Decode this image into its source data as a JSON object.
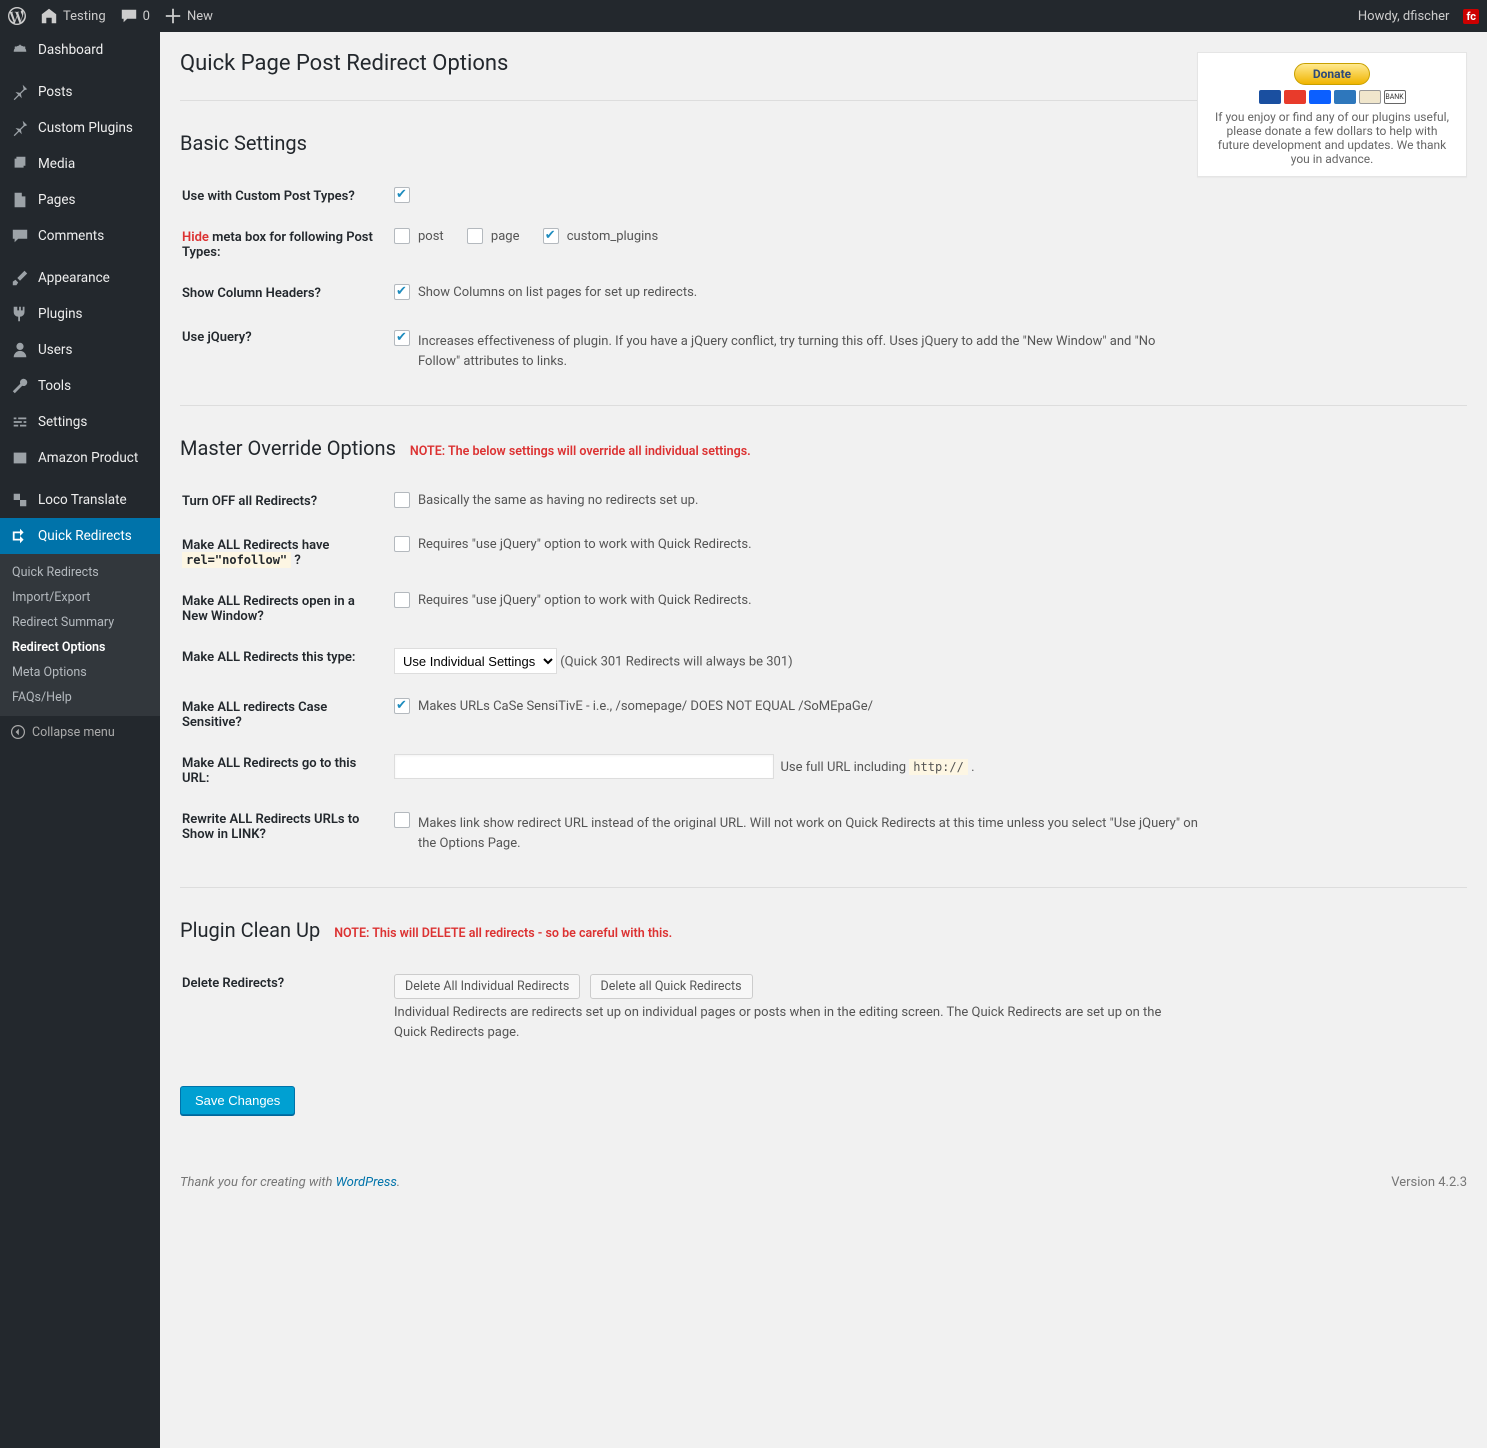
{
  "adminbar": {
    "site": "Testing",
    "comments": "0",
    "new": "New",
    "howdy": "Howdy, dfischer",
    "fc": "fc"
  },
  "menu": {
    "dashboard": "Dashboard",
    "posts": "Posts",
    "custom_plugins": "Custom Plugins",
    "media": "Media",
    "pages": "Pages",
    "comments": "Comments",
    "appearance": "Appearance",
    "plugins": "Plugins",
    "users": "Users",
    "tools": "Tools",
    "settings": "Settings",
    "amazon": "Amazon Product",
    "loco": "Loco Translate",
    "quick_redirects": "Quick Redirects",
    "collapse": "Collapse menu",
    "sub": {
      "quick_redirects": "Quick Redirects",
      "import_export": "Import/Export",
      "redirect_summary": "Redirect Summary",
      "redirect_options": "Redirect Options",
      "meta_options": "Meta Options",
      "faqs_help": "FAQs/Help"
    }
  },
  "page_title": "Quick Page Post Redirect Options",
  "donate": {
    "button": "Donate",
    "bank": "BANK",
    "text": "If you enjoy or find any of our plugins useful, please donate a few dollars to help with future development and updates. We thank you in advance."
  },
  "basic": {
    "title": "Basic Settings",
    "use_cpt_label": "Use with Custom Post Types?",
    "hide_word": "Hide",
    "hide_rest": "meta box for following Post Types:",
    "opt_post": "post",
    "opt_page": "page",
    "opt_cp": "custom_plugins",
    "show_columns_label": "Show Column Headers?",
    "show_columns_desc": "Show Columns on list pages for set up redirects.",
    "use_jquery_label": "Use jQuery?",
    "use_jquery_desc": "Increases effectiveness of plugin. If you have a jQuery conflict, try turning this off. Uses jQuery to add the \"New Window\" and \"No Follow\" attributes to links."
  },
  "master": {
    "title": "Master Override Options",
    "note": "NOTE: The below settings will override all individual settings.",
    "turn_off_label": "Turn OFF all Redirects?",
    "turn_off_desc": "Basically the same as having no redirects set up.",
    "nofollow_label_a": "Make ALL Redirects have ",
    "nofollow_code": "rel=\"nofollow\"",
    "nofollow_label_b": " ?",
    "nofollow_desc": "Requires \"use jQuery\" option to work with Quick Redirects.",
    "new_window_label": "Make ALL Redirects open in a New Window?",
    "new_window_desc": "Requires \"use jQuery\" option to work with Quick Redirects.",
    "this_type_label": "Make ALL Redirects this type:",
    "this_type_option": "Use Individual Settings",
    "this_type_desc": "(Quick 301 Redirects will always be 301)",
    "case_label": "Make ALL redirects Case Sensitive?",
    "case_desc": "Makes URLs CaSe SensiTivE - i.e., /somepage/ DOES NOT EQUAL /SoMEpaGe/",
    "goto_label": "Make ALL Redirects go to this URL:",
    "goto_desc_a": "Use full URL including ",
    "goto_code": "http://",
    "goto_desc_b": " .",
    "rewrite_label": "Rewrite ALL Redirects URLs to Show in LINK?",
    "rewrite_desc": "Makes link show redirect URL instead of the original URL. Will not work on Quick Redirects at this time unless you select \"Use jQuery\" on the Options Page."
  },
  "cleanup": {
    "title": "Plugin Clean Up",
    "note": "NOTE: This will DELETE all redirects - so be careful with this.",
    "delete_label": "Delete Redirects?",
    "btn_individual": "Delete All Individual Redirects",
    "btn_quick": "Delete all Quick Redirects",
    "desc": "Individual Redirects are redirects set up on individual pages or posts when in the editing screen. The Quick Redirects are set up on the Quick Redirects page."
  },
  "save": "Save Changes",
  "footer": {
    "thanks_a": "Thank you for creating with ",
    "wp": "WordPress",
    "thanks_b": ".",
    "version": "Version 4.2.3"
  }
}
